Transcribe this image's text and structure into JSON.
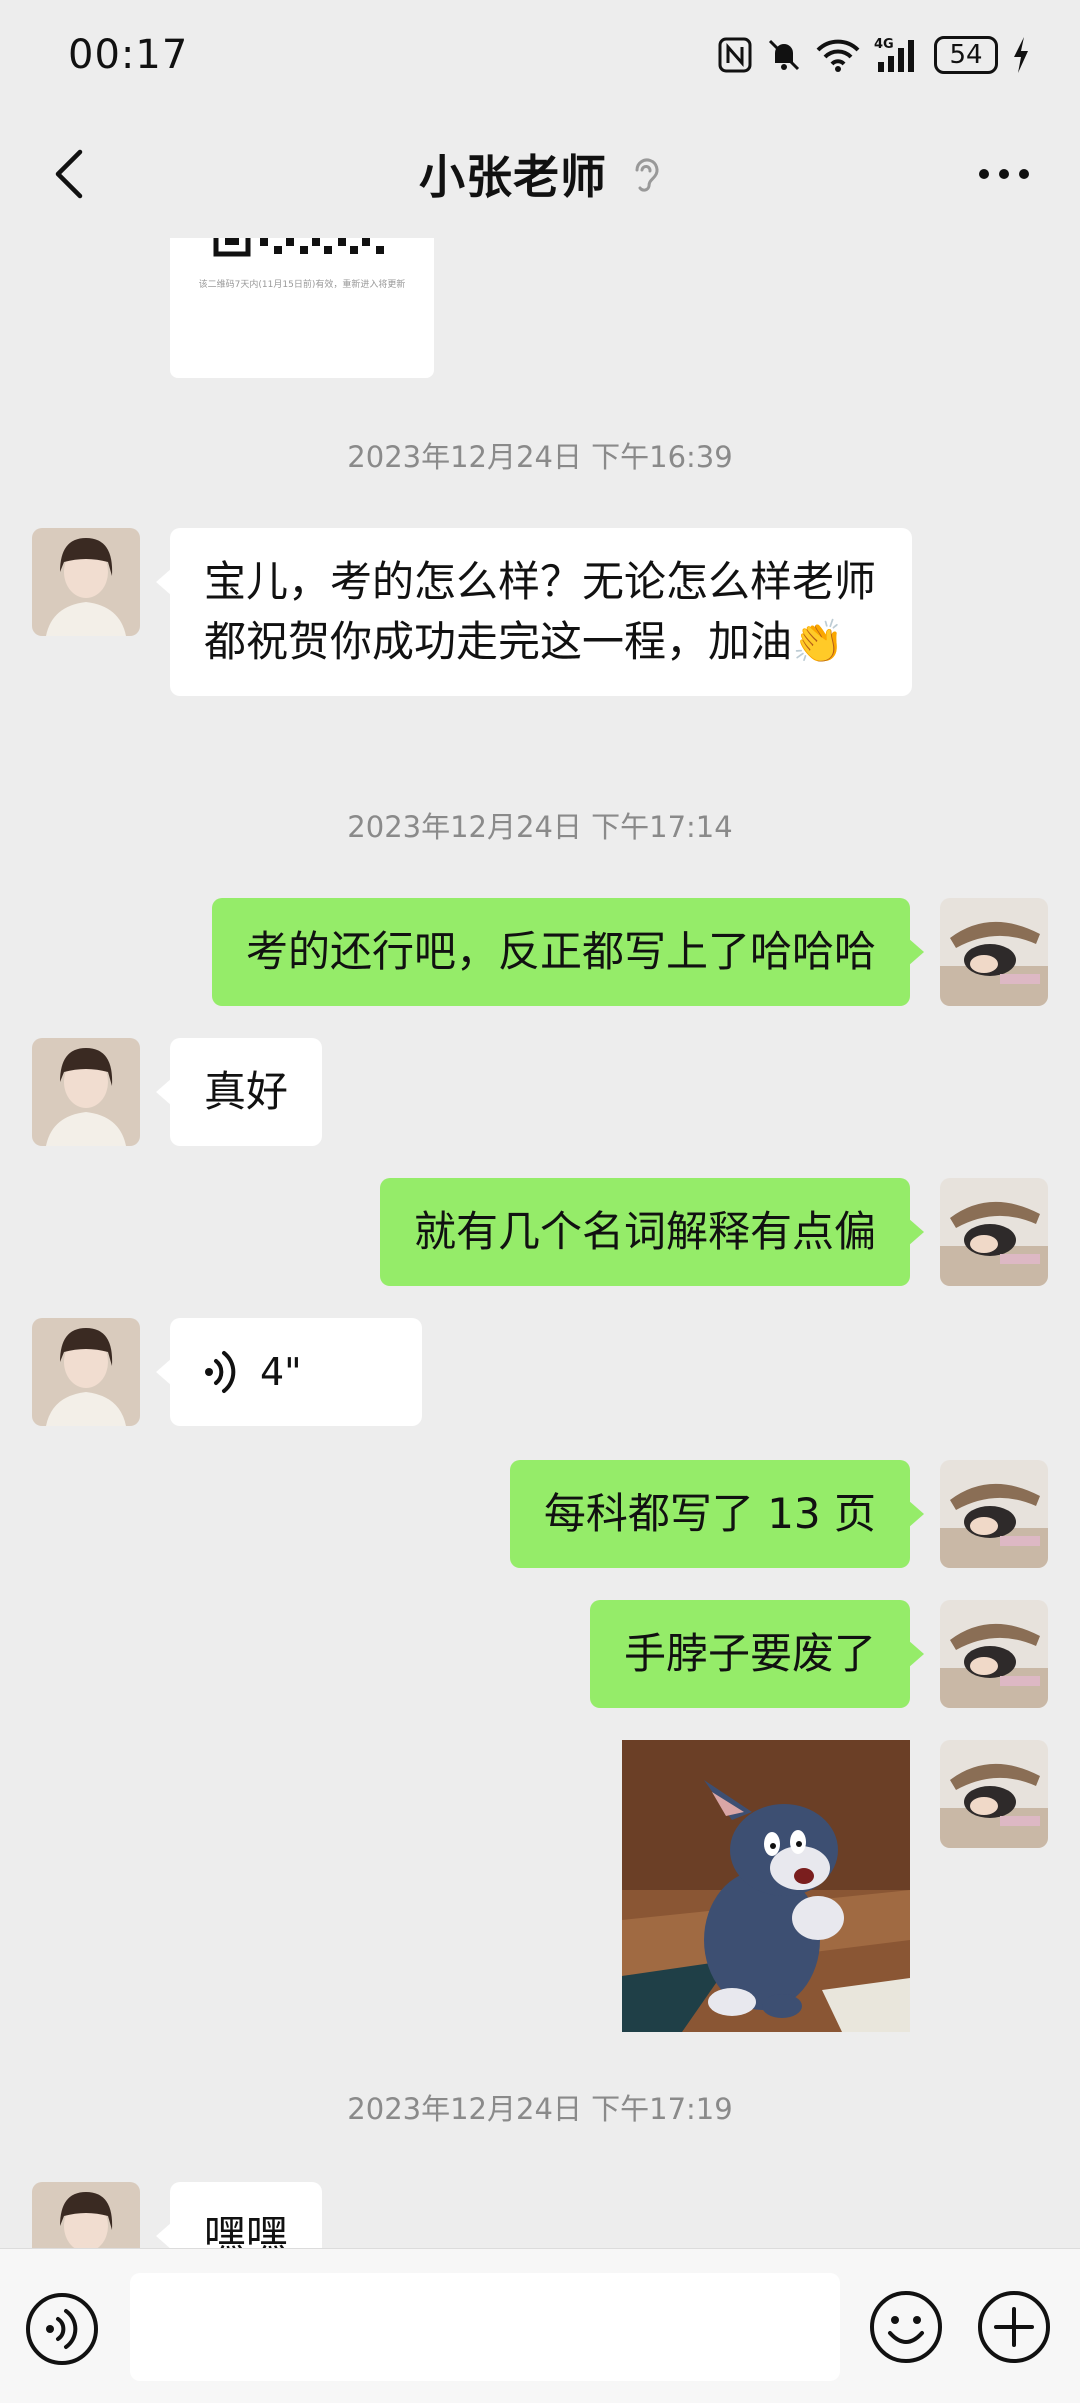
{
  "status_bar": {
    "time": "00:17",
    "battery": "54",
    "network": "4G",
    "icons": [
      "nfc-icon",
      "mute-bell-icon",
      "wifi-icon",
      "signal-icon",
      "charging-icon"
    ]
  },
  "header": {
    "title": "小张老师",
    "icons": [
      "back-arrow-icon",
      "ear-icon",
      "more-dots-icon"
    ]
  },
  "chat": {
    "qr_caption": "该二维码7天内(11月15日前)有效，重新进入将更新",
    "messages": [
      {
        "type": "timestamp",
        "text": "2023年12月24日 下午16:39"
      },
      {
        "type": "text",
        "from": "them",
        "text": "宝儿，考的怎么样？无论怎么样老师都祝贺你成功走完这一程，加油👏"
      },
      {
        "type": "timestamp",
        "text": "2023年12月24日 下午17:14"
      },
      {
        "type": "text",
        "from": "me",
        "text": "考的还行吧，反正都写上了哈哈哈"
      },
      {
        "type": "text",
        "from": "them",
        "text": "真好"
      },
      {
        "type": "text",
        "from": "me",
        "text": "就有几个名词解释有点偏"
      },
      {
        "type": "voice",
        "from": "them",
        "duration": "4\""
      },
      {
        "type": "text",
        "from": "me",
        "text": "每科都写了 13 页"
      },
      {
        "type": "text",
        "from": "me",
        "text": "手脖子要废了"
      },
      {
        "type": "sticker",
        "from": "me",
        "description": "tom-cat-sticker"
      },
      {
        "type": "timestamp",
        "text": "2023年12月24日 下午17:19"
      },
      {
        "type": "text",
        "from": "them",
        "text": "嘿嘿"
      }
    ]
  },
  "input_bar": {
    "placeholder": "",
    "icons": [
      "voice-input-icon",
      "emoji-icon",
      "plus-icon"
    ]
  },
  "colors": {
    "background": "#ededed",
    "outgoing_bubble": "#95ec69",
    "incoming_bubble": "#ffffff",
    "timestamp_text": "#8a8a8a"
  }
}
